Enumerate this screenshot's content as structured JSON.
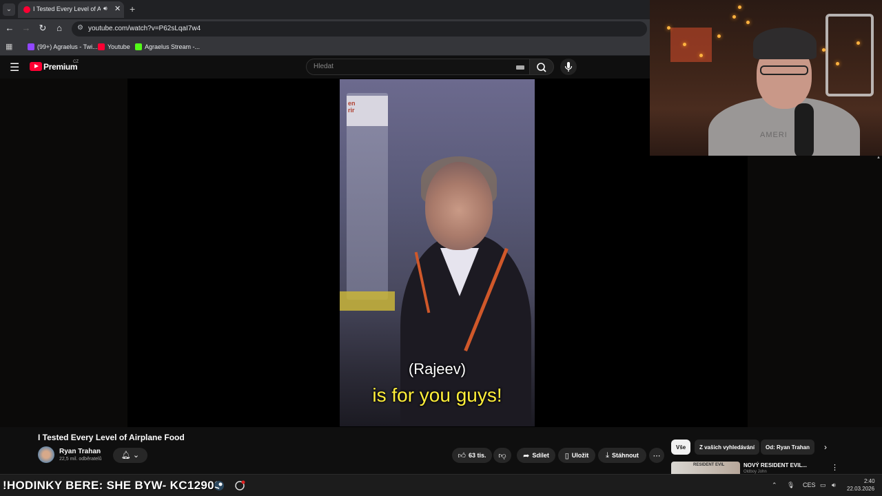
{
  "browser": {
    "tab_title": "I Tested Every Level of Airplane Food",
    "url": "youtube.com/watch?v=P62sLqaI7w4",
    "bookmarks": [
      {
        "label": "(99+) Agraelus - Twi...",
        "color": "#9146ff"
      },
      {
        "label": "Youtube",
        "color": "#ff0033"
      },
      {
        "label": "Agraelus Stream -...",
        "color": "#53fc18"
      }
    ]
  },
  "youtube": {
    "brand": "Premium",
    "country": "CZ",
    "search_placeholder": "Hledat"
  },
  "video": {
    "caption_line1": "(Rajeev)",
    "caption_line2": "is for you guys!",
    "scene_sign_text": "en\nrir",
    "title": "I Tested Every Level of Airplane Food",
    "channel": "Ryan Trahan",
    "subscribers": "22,5 mil. odběratelů",
    "likes": "63 tis.",
    "share_label": "Sdílet",
    "save_label": "Uložit",
    "download_label": "Stáhnout"
  },
  "webcam": {
    "shirt_text": "AMERI"
  },
  "sidebar": {
    "chips": [
      {
        "label": "Vše",
        "active": true
      },
      {
        "label": "Z vašich vyhledávání",
        "active": false
      },
      {
        "label": "Od: Ryan Trahan",
        "active": false
      }
    ],
    "recommendation": {
      "thumb_text": "RESIDENT EVIL",
      "title": "NOVÝ RESIDENT EVIL...",
      "channel": "Oldboy John"
    }
  },
  "taskbar": {
    "ticker": "!HODINKY BERE: SHE  BYW- KC12900",
    "language": "CES",
    "time": "2:40",
    "date": "22.03.2026"
  },
  "colors": {
    "youtube_red": "#ff0033",
    "caption_yellow": "#ffef3a",
    "background": "#0f0f0f"
  }
}
